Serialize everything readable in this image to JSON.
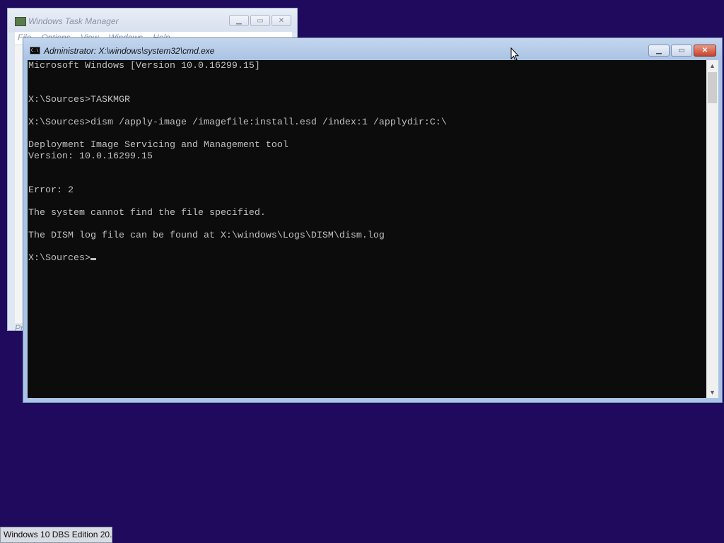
{
  "task_manager": {
    "title": "Windows Task Manager",
    "menu": [
      "File",
      "Options",
      "View",
      "Windows",
      "Help"
    ],
    "status_text": "Pr",
    "icon": "task-manager-icon"
  },
  "cmd_window": {
    "title": "Administrator: X:\\windows\\system32\\cmd.exe",
    "icon_label": "C:\\",
    "buttons": {
      "minimize": "minimize-icon",
      "maximize": "maximize-icon",
      "close": "close-icon"
    },
    "console_lines": [
      "Microsoft Windows [Version 10.0.16299.15]",
      "",
      "",
      "X:\\Sources>TASKMGR",
      "",
      "X:\\Sources>dism /apply-image /imagefile:install.esd /index:1 /applydir:C:\\",
      "",
      "Deployment Image Servicing and Management tool",
      "Version: 10.0.16299.15",
      "",
      "",
      "Error: 2",
      "",
      "The system cannot find the file specified.",
      "",
      "The DISM log file can be found at X:\\windows\\Logs\\DISM\\dism.log",
      ""
    ],
    "prompt": "X:\\Sources>"
  },
  "taskbar": {
    "item_label": "Windows 10 DBS Edition 20..."
  },
  "colors": {
    "desktop": "#1f0a5e",
    "console_bg": "#0c0c0c",
    "console_fg": "#c0c0c0",
    "close_button": "#c6412b"
  }
}
